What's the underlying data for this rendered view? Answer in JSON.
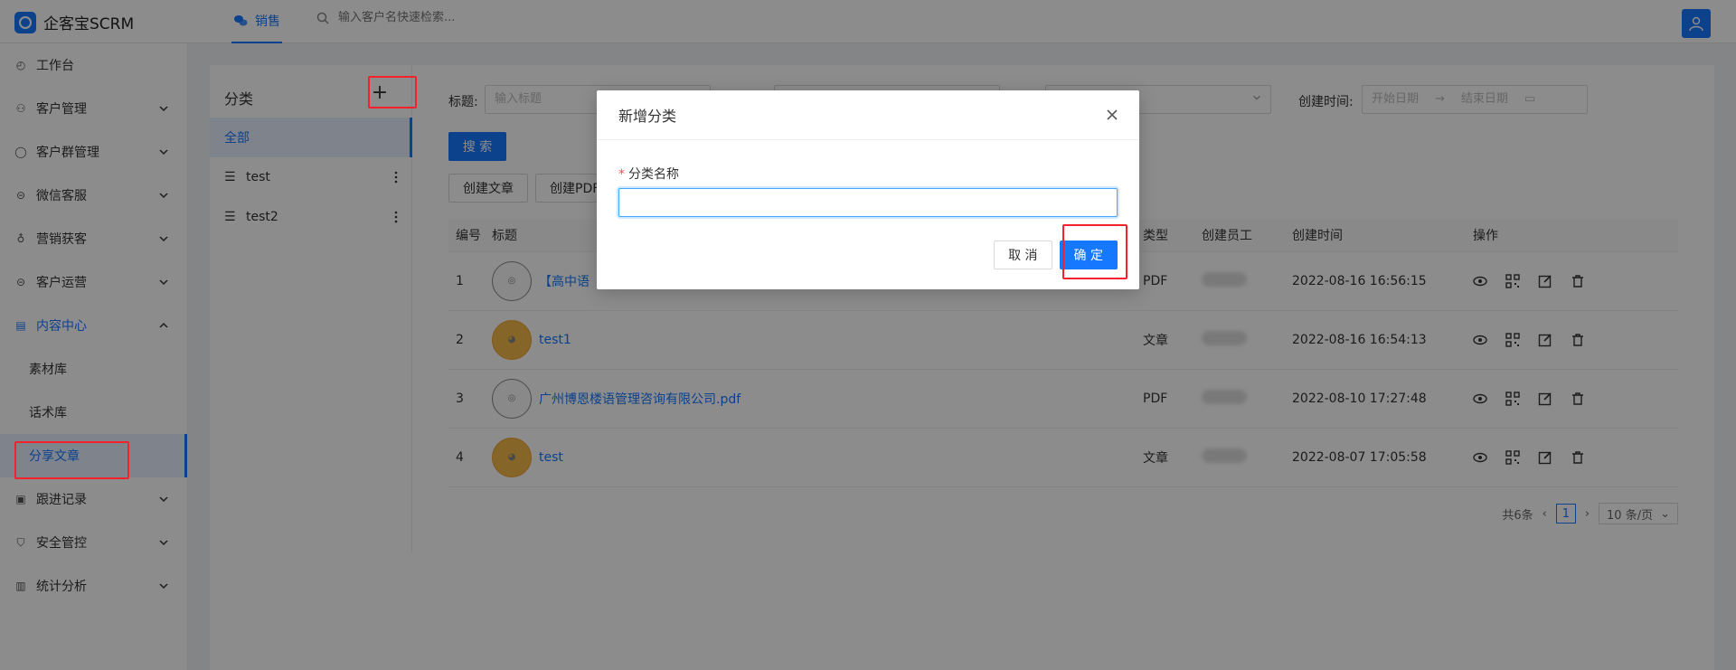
{
  "app": {
    "title": "企客宝SCRM"
  },
  "header": {
    "nav_tab": "销售",
    "search_placeholder": "输入客户名快速检索..."
  },
  "sidebar": {
    "items": [
      {
        "label": "工作台",
        "icon": "dashboard-icon"
      },
      {
        "label": "客户管理",
        "icon": "user-group-icon"
      },
      {
        "label": "客户群管理",
        "icon": "chat-icon"
      },
      {
        "label": "微信客服",
        "icon": "service-icon"
      },
      {
        "label": "营销获客",
        "icon": "bulb-icon"
      },
      {
        "label": "客户运营",
        "icon": "operation-icon"
      },
      {
        "label": "内容中心",
        "icon": "content-icon"
      },
      {
        "label": "跟进记录",
        "icon": "record-icon"
      },
      {
        "label": "安全管控",
        "icon": "shield-icon"
      },
      {
        "label": "统计分析",
        "icon": "chart-icon"
      }
    ],
    "sub_items": [
      "素材库",
      "话术库",
      "分享文章"
    ]
  },
  "category": {
    "title": "分类",
    "items": [
      "全部",
      "test",
      "test2"
    ]
  },
  "filters": {
    "title_label": "标题:",
    "title_placeholder": "输入标题",
    "created_label": "创建时间:",
    "start_placeholder": "开始日期",
    "arrow": "→",
    "end_placeholder": "结束日期",
    "search_btn": "搜 索",
    "create_article_btn": "创建文章",
    "create_pdf_btn": "创建PDF"
  },
  "table": {
    "headers": [
      "编号",
      "标题",
      "类型",
      "创建员工",
      "创建时间",
      "操作"
    ],
    "rows": [
      {
        "no": "1",
        "title": "【高中语",
        "type": "PDF",
        "time": "2022-08-16 16:56:15",
        "thumb": "cup"
      },
      {
        "no": "2",
        "title": "test1",
        "type": "文章",
        "time": "2022-08-16 16:54:13",
        "thumb": "cat"
      },
      {
        "no": "3",
        "title": "广州博恩楼语管理咨询有限公司.pdf",
        "type": "PDF",
        "time": "2022-08-10 17:27:48",
        "thumb": "cup"
      },
      {
        "no": "4",
        "title": "test",
        "type": "文章",
        "time": "2022-08-07 17:05:58",
        "thumb": "cat"
      }
    ]
  },
  "pager": {
    "total": "共6条",
    "current": "1",
    "size": "10 条/页"
  },
  "modal": {
    "title": "新增分类",
    "field_label": "分类名称",
    "required_mark": "*",
    "input_value": "",
    "cancel": "取 消",
    "ok": "确 定"
  },
  "colors": {
    "primary": "#1677ff",
    "highlight": "#f5222d"
  }
}
